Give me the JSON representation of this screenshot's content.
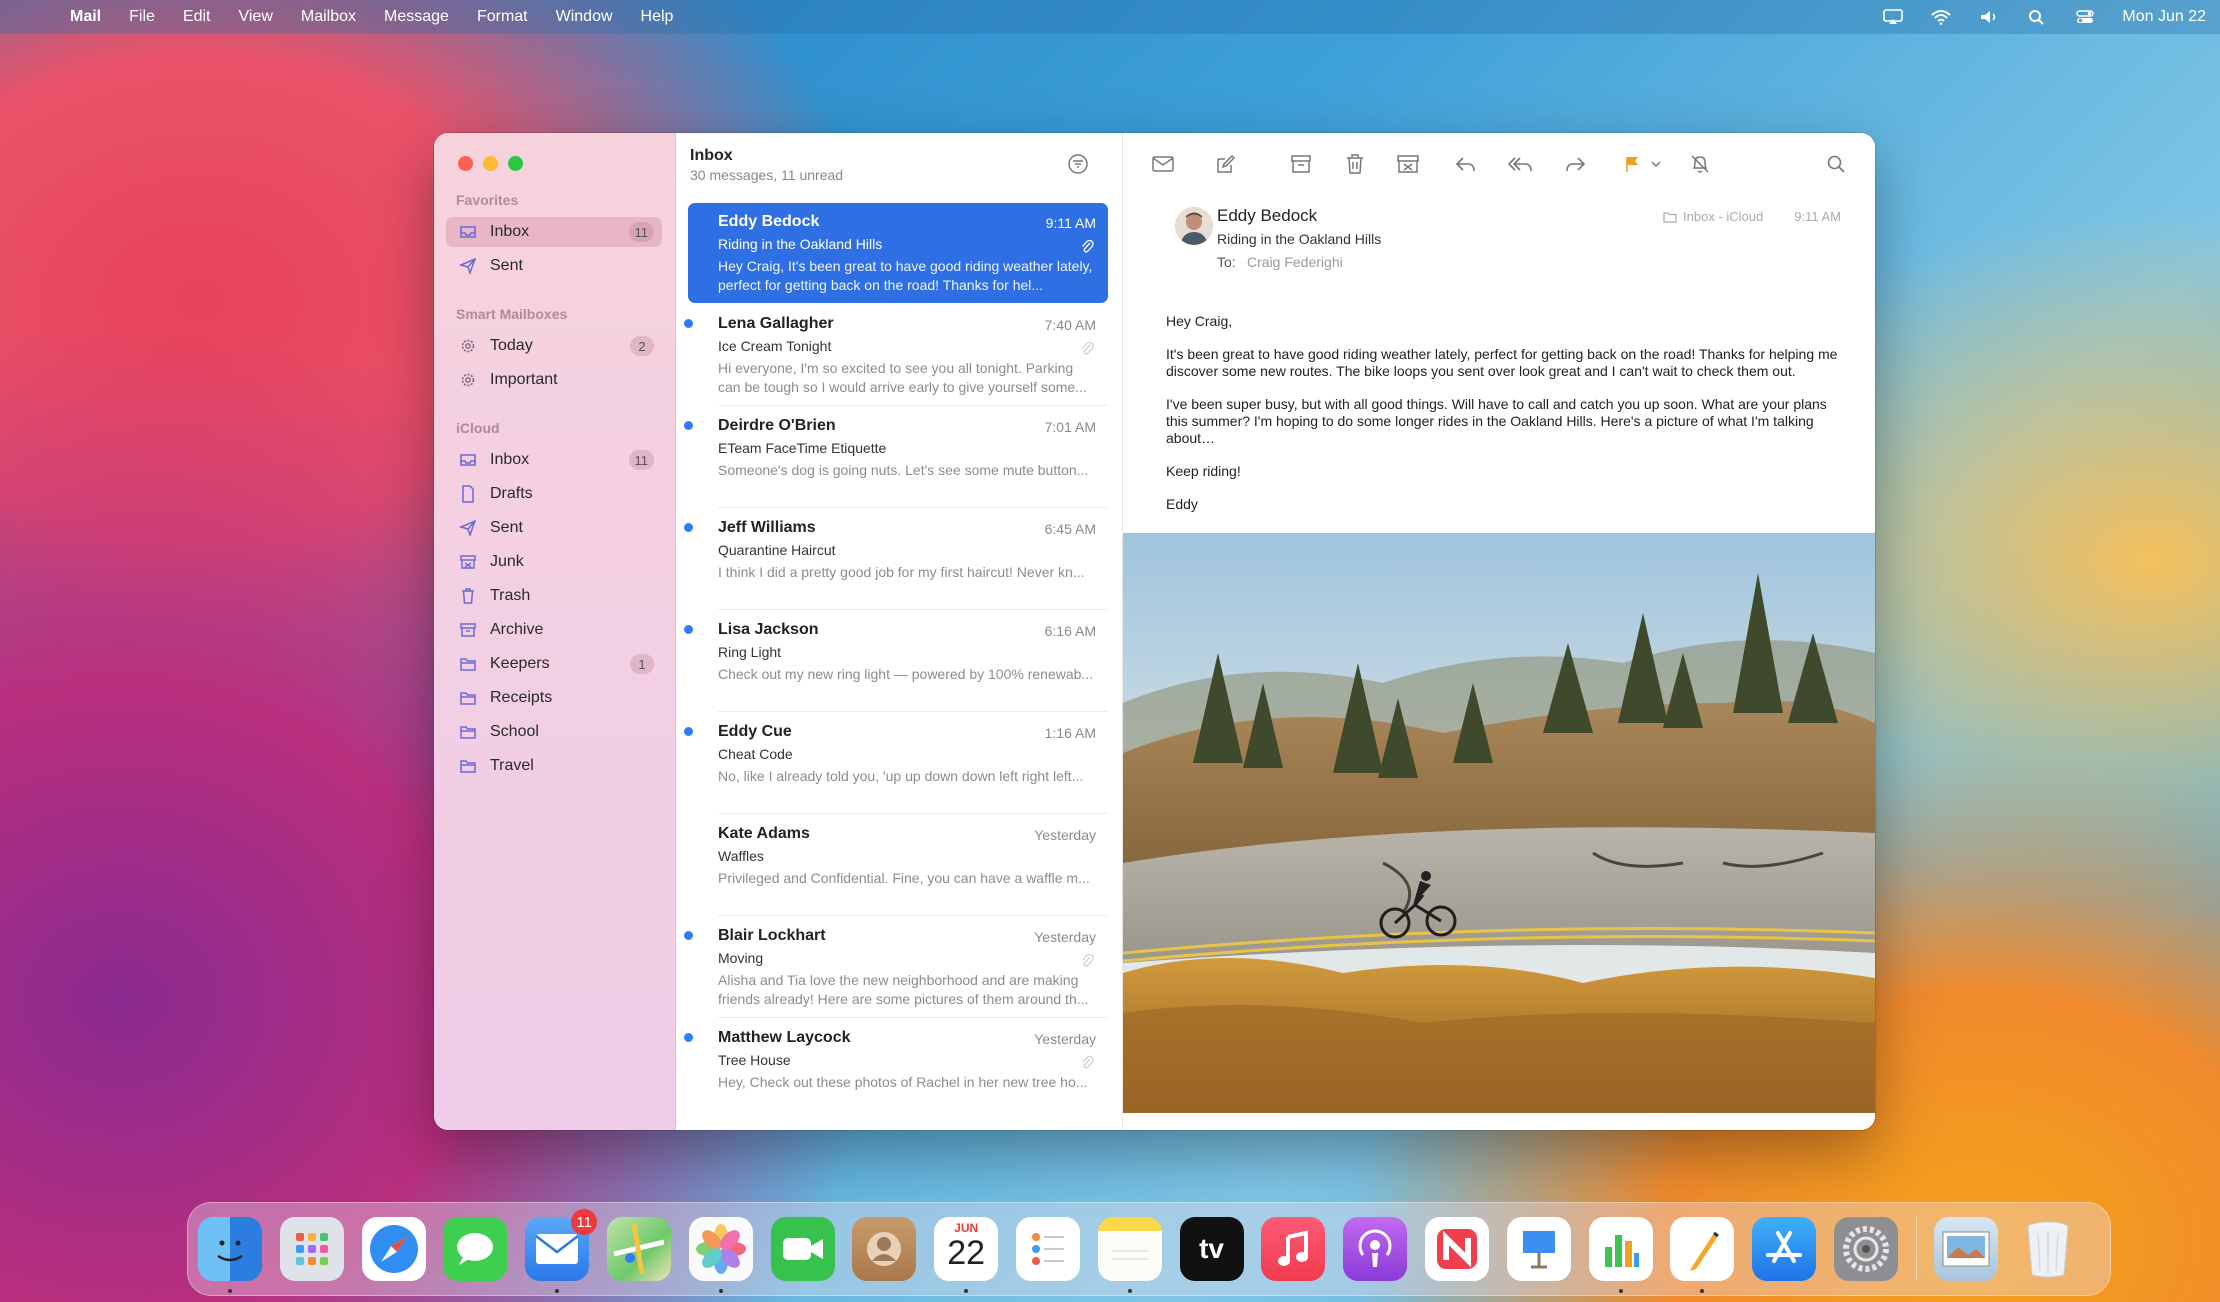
{
  "menubar": {
    "app_name": "Mail",
    "items": [
      "File",
      "Edit",
      "View",
      "Mailbox",
      "Message",
      "Format",
      "Window",
      "Help"
    ],
    "clock": "Mon Jun 22"
  },
  "sidebar": {
    "favorites_header": "Favorites",
    "favorites": [
      {
        "label": "Inbox",
        "icon": "inbox-icon",
        "badge": "11",
        "selected": true
      },
      {
        "label": "Sent",
        "icon": "paperplane-icon",
        "badge": ""
      }
    ],
    "smart_header": "Smart Mailboxes",
    "smart": [
      {
        "label": "Today",
        "icon": "gear-icon",
        "badge": "2"
      },
      {
        "label": "Important",
        "icon": "gear-icon",
        "badge": ""
      }
    ],
    "icloud_header": "iCloud",
    "icloud": [
      {
        "label": "Inbox",
        "icon": "inbox-icon",
        "badge": "11"
      },
      {
        "label": "Drafts",
        "icon": "document-icon",
        "badge": ""
      },
      {
        "label": "Sent",
        "icon": "paperplane-icon",
        "badge": ""
      },
      {
        "label": "Junk",
        "icon": "junk-icon",
        "badge": ""
      },
      {
        "label": "Trash",
        "icon": "trash-icon",
        "badge": ""
      },
      {
        "label": "Archive",
        "icon": "archive-icon",
        "badge": ""
      },
      {
        "label": "Keepers",
        "icon": "folder-icon",
        "badge": "1"
      },
      {
        "label": "Receipts",
        "icon": "folder-icon",
        "badge": ""
      },
      {
        "label": "School",
        "icon": "folder-icon",
        "badge": ""
      },
      {
        "label": "Travel",
        "icon": "folder-icon",
        "badge": ""
      }
    ]
  },
  "list": {
    "title": "Inbox",
    "subtitle": "30 messages, 11 unread",
    "messages": [
      {
        "from": "Eddy Bedock",
        "time": "9:11 AM",
        "subject": "Riding in the Oakland Hills",
        "preview": "Hey Craig, It's been great to have good riding weather lately, perfect for getting back on the road! Thanks for hel...",
        "unread": false,
        "selected": true,
        "attachment": true
      },
      {
        "from": "Lena Gallagher",
        "time": "7:40 AM",
        "subject": "Ice Cream Tonight",
        "preview": "Hi everyone, I'm so excited to see you all tonight. Parking can be tough so I would arrive early to give yourself some...",
        "unread": true,
        "attachment": true
      },
      {
        "from": "Deirdre O'Brien",
        "time": "7:01 AM",
        "subject": "ETeam FaceTime Etiquette",
        "preview": "Someone's dog is going nuts. Let's see some mute button...",
        "unread": true,
        "attachment": false
      },
      {
        "from": "Jeff Williams",
        "time": "6:45 AM",
        "subject": "Quarantine Haircut",
        "preview": "I think I did a pretty good job for my first haircut! Never kn...",
        "unread": true,
        "attachment": false
      },
      {
        "from": "Lisa Jackson",
        "time": "6:16 AM",
        "subject": "Ring Light",
        "preview": "Check out my new ring light — powered by 100% renewab...",
        "unread": true,
        "attachment": false
      },
      {
        "from": "Eddy Cue",
        "time": "1:16 AM",
        "subject": "Cheat Code",
        "preview": "No, like I already told you, 'up up down down left right left...",
        "unread": true,
        "attachment": false
      },
      {
        "from": "Kate Adams",
        "time": "Yesterday",
        "subject": "Waffles",
        "preview": "Privileged and Confidential. Fine, you can have a waffle m...",
        "unread": false,
        "attachment": false
      },
      {
        "from": "Blair Lockhart",
        "time": "Yesterday",
        "subject": "Moving",
        "preview": "Alisha and Tia love the new neighborhood and are making friends already! Here are some pictures of them around th...",
        "unread": true,
        "attachment": true
      },
      {
        "from": "Matthew Laycock",
        "time": "Yesterday",
        "subject": "Tree House",
        "preview": "Hey, Check out these photos of Rachel in her new tree ho...",
        "unread": true,
        "attachment": true
      }
    ]
  },
  "reader": {
    "from": "Eddy Bedock",
    "subject": "Riding in the Oakland Hills",
    "to_label": "To:",
    "to": "Craig Federighi",
    "mailbox": "Inbox - iCloud",
    "time": "9:11 AM",
    "body": [
      "Hey Craig,",
      "It's been great to have good riding weather lately, perfect for getting back on the road! Thanks for helping me discover some new routes. The bike loops you sent over look great and I can't wait to check them out.",
      "I've been super busy, but with all good things. Will have to call and catch you up soon. What are your plans this summer? I'm hoping to do some longer rides in the Oakland Hills. Here's a picture of what I'm talking about…",
      "Keep riding!",
      "Eddy"
    ]
  },
  "dock": {
    "apps": [
      {
        "name": "Finder",
        "icon": "finder-icon",
        "color": "#3a8ff0"
      },
      {
        "name": "Launchpad",
        "icon": "launchpad-icon",
        "color": "#d9dde3"
      },
      {
        "name": "Safari",
        "icon": "safari-icon",
        "color": "#2f8ef0"
      },
      {
        "name": "Messages",
        "icon": "messages-icon",
        "color": "#3fcf4e"
      },
      {
        "name": "Mail",
        "icon": "mail-icon",
        "color": "#3b8bf2",
        "badge": "11"
      },
      {
        "name": "Maps",
        "icon": "maps-icon",
        "color": "#6ec96a"
      },
      {
        "name": "Photos",
        "icon": "photos-icon",
        "color": "#f4f4f4"
      },
      {
        "name": "FaceTime",
        "icon": "facetime-icon",
        "color": "#36c24d"
      },
      {
        "name": "Contacts",
        "icon": "contacts-icon",
        "color": "#b88a5a"
      },
      {
        "name": "Calendar",
        "icon": "calendar-icon",
        "color": "#ffffff",
        "month": "JUN",
        "day": "22"
      },
      {
        "name": "Reminders",
        "icon": "reminders-icon",
        "color": "#ffffff"
      },
      {
        "name": "Notes",
        "icon": "notes-icon",
        "color": "#fbd84a"
      },
      {
        "name": "Apple TV",
        "icon": "tv-icon",
        "color": "#111111",
        "label": "tv"
      },
      {
        "name": "Music",
        "icon": "music-icon",
        "color": "#f4445c"
      },
      {
        "name": "Podcasts",
        "icon": "podcasts-icon",
        "color": "#9a4de0"
      },
      {
        "name": "News",
        "icon": "news-icon",
        "color": "#ffffff"
      },
      {
        "name": "Keynote",
        "icon": "keynote-icon",
        "color": "#ffffff"
      },
      {
        "name": "Numbers",
        "icon": "numbers-icon",
        "color": "#ffffff"
      },
      {
        "name": "Pages",
        "icon": "pages-icon",
        "color": "#ffffff"
      },
      {
        "name": "App Store",
        "icon": "appstore-icon",
        "color": "#2d8ef3"
      },
      {
        "name": "System Preferences",
        "icon": "settings-icon",
        "color": "#8e8e93"
      },
      {
        "name": "Preview",
        "icon": "preview-icon",
        "color": "#c8d8e8"
      },
      {
        "name": "Trash",
        "icon": "trash-icon",
        "color": "#e9edf0"
      }
    ]
  }
}
